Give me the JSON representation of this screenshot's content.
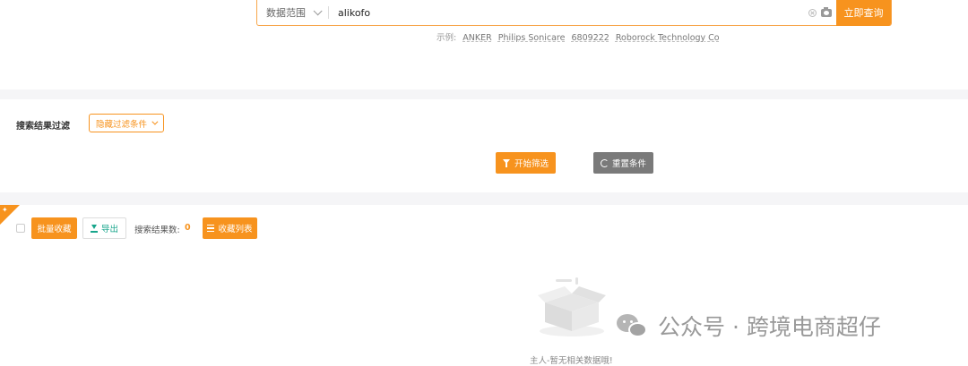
{
  "search": {
    "scope_label": "数据范围",
    "query_value": "alikofo",
    "submit_label": "立即查询",
    "examples_label": "示例:",
    "examples": [
      "ANKER",
      "Philips Sonicare",
      "6809222",
      "Roborock Technology Co"
    ]
  },
  "filter": {
    "section_label": "搜索结果过滤",
    "toggle_label": "隐藏过滤条件",
    "start_label": "开始筛选",
    "reset_label": "重置条件"
  },
  "results": {
    "batch_label": "批量收藏",
    "export_label": "导出",
    "count_label": "搜索结果数:",
    "count_value": "0",
    "fav_list_label": "收藏列表",
    "empty_text": "主人-暂无相关数据哦!"
  },
  "watermark": {
    "text": "公众号 · 跨境电商超仔"
  },
  "colors": {
    "accent": "#f7931e",
    "reset": "#7a7a7a",
    "export": "#17a58b",
    "band": "#f5f5f7"
  },
  "icons": [
    "chevron-down-icon",
    "clear-icon",
    "camera-icon",
    "funnel-icon",
    "refresh-icon",
    "pin-icon",
    "download-icon",
    "list-icon",
    "empty-box-icon",
    "wechat-icon"
  ]
}
